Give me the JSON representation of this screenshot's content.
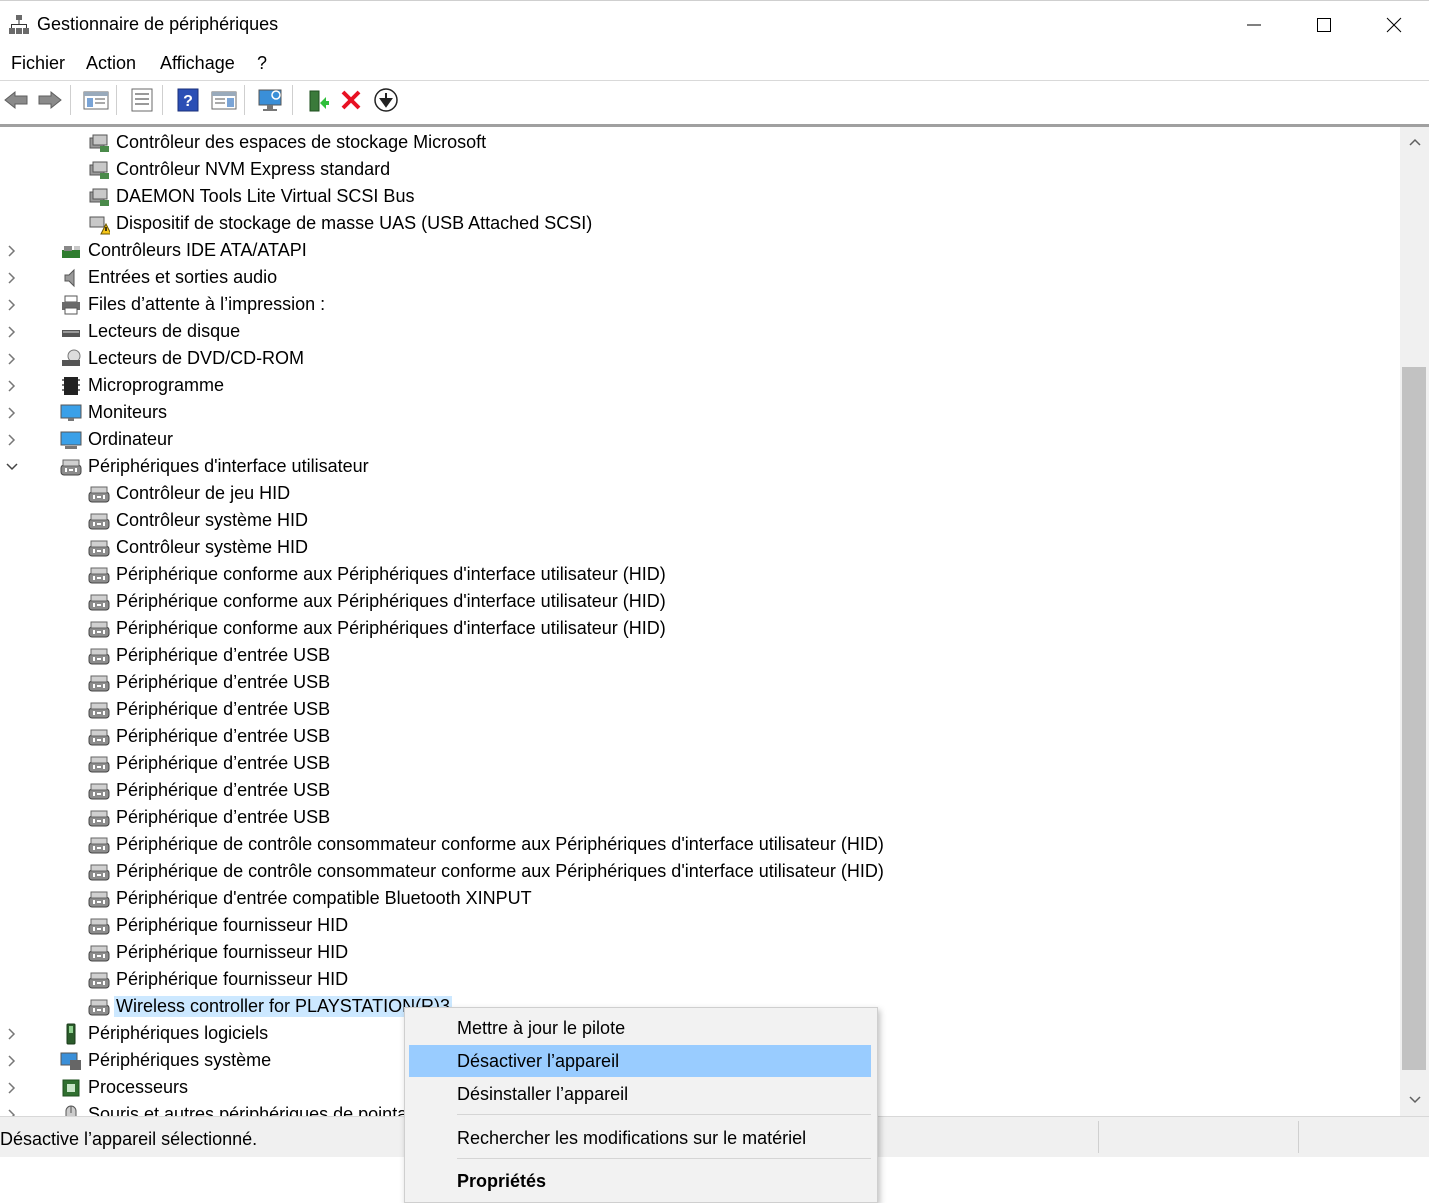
{
  "window": {
    "title": "Gestionnaire de périphériques"
  },
  "menu": {
    "items": [
      "Fichier",
      "Action",
      "Affichage",
      "?"
    ]
  },
  "toolbar": {
    "buttons": [
      "back-arrow-icon",
      "forward-arrow-icon",
      "show-hide-console-tree-icon",
      "properties-icon",
      "help-icon",
      "action-pane-icon",
      "scan-hardware-icon",
      "update-driver-icon",
      "uninstall-icon",
      "disable-icon"
    ]
  },
  "tree": {
    "storage_children": [
      "Contrôleur des espaces de stockage Microsoft",
      "Contrôleur NVM Express standard",
      "DAEMON Tools Lite Virtual SCSI Bus",
      "Dispositif de stockage de masse UAS (USB Attached SCSI)"
    ],
    "categories_before": [
      {
        "label": "Contrôleurs IDE ATA/ATAPI",
        "icon": "ide-controller-icon"
      },
      {
        "label": "Entrées et sorties audio",
        "icon": "speaker-icon"
      },
      {
        "label": "Files d’attente à l’impression :",
        "icon": "printer-icon"
      },
      {
        "label": "Lecteurs de disque",
        "icon": "disk-drive-icon"
      },
      {
        "label": "Lecteurs de DVD/CD-ROM",
        "icon": "dvd-drive-icon"
      },
      {
        "label": "Microprogramme",
        "icon": "firmware-chip-icon"
      },
      {
        "label": "Moniteurs",
        "icon": "monitor-icon"
      },
      {
        "label": "Ordinateur",
        "icon": "computer-icon"
      }
    ],
    "hid_category": "Périphériques d'interface utilisateur",
    "hid_children": [
      "Contrôleur de jeu HID",
      "Contrôleur système HID",
      "Contrôleur système HID",
      "Périphérique conforme aux Périphériques d'interface utilisateur (HID)",
      "Périphérique conforme aux Périphériques d'interface utilisateur (HID)",
      "Périphérique conforme aux Périphériques d'interface utilisateur (HID)",
      "Périphérique d’entrée USB",
      "Périphérique d’entrée USB",
      "Périphérique d’entrée USB",
      "Périphérique d’entrée USB",
      "Périphérique d’entrée USB",
      "Périphérique d’entrée USB",
      "Périphérique d’entrée USB",
      "Périphérique de contrôle consommateur conforme aux Périphériques d'interface utilisateur (HID)",
      "Périphérique de contrôle consommateur conforme aux Périphériques d'interface utilisateur (HID)",
      "Périphérique d'entrée compatible Bluetooth XINPUT",
      "Périphérique fournisseur HID",
      "Périphérique fournisseur HID",
      "Périphérique fournisseur HID",
      "Wireless controller for PLAYSTATION(R)3"
    ],
    "categories_after": [
      {
        "label": "Périphériques logiciels",
        "icon": "software-device-icon"
      },
      {
        "label": "Périphériques système",
        "icon": "system-device-icon"
      },
      {
        "label": "Processeurs",
        "icon": "processor-icon"
      },
      {
        "label": "Souris et autres périphériques de pointage",
        "icon": "mouse-icon"
      }
    ]
  },
  "context_menu": {
    "update": "Mettre à jour le pilote",
    "disable": "Désactiver l’appareil",
    "uninstall": "Désinstaller l’appareil",
    "scan": "Rechercher les modifications sur le matériel",
    "properties": "Propriétés"
  },
  "status": {
    "text": "Désactive l’appareil sélectionné."
  },
  "colors": {
    "selection": "#cce8ff",
    "menu_highlight": "#99ccff",
    "delete_red": "#e81123"
  }
}
